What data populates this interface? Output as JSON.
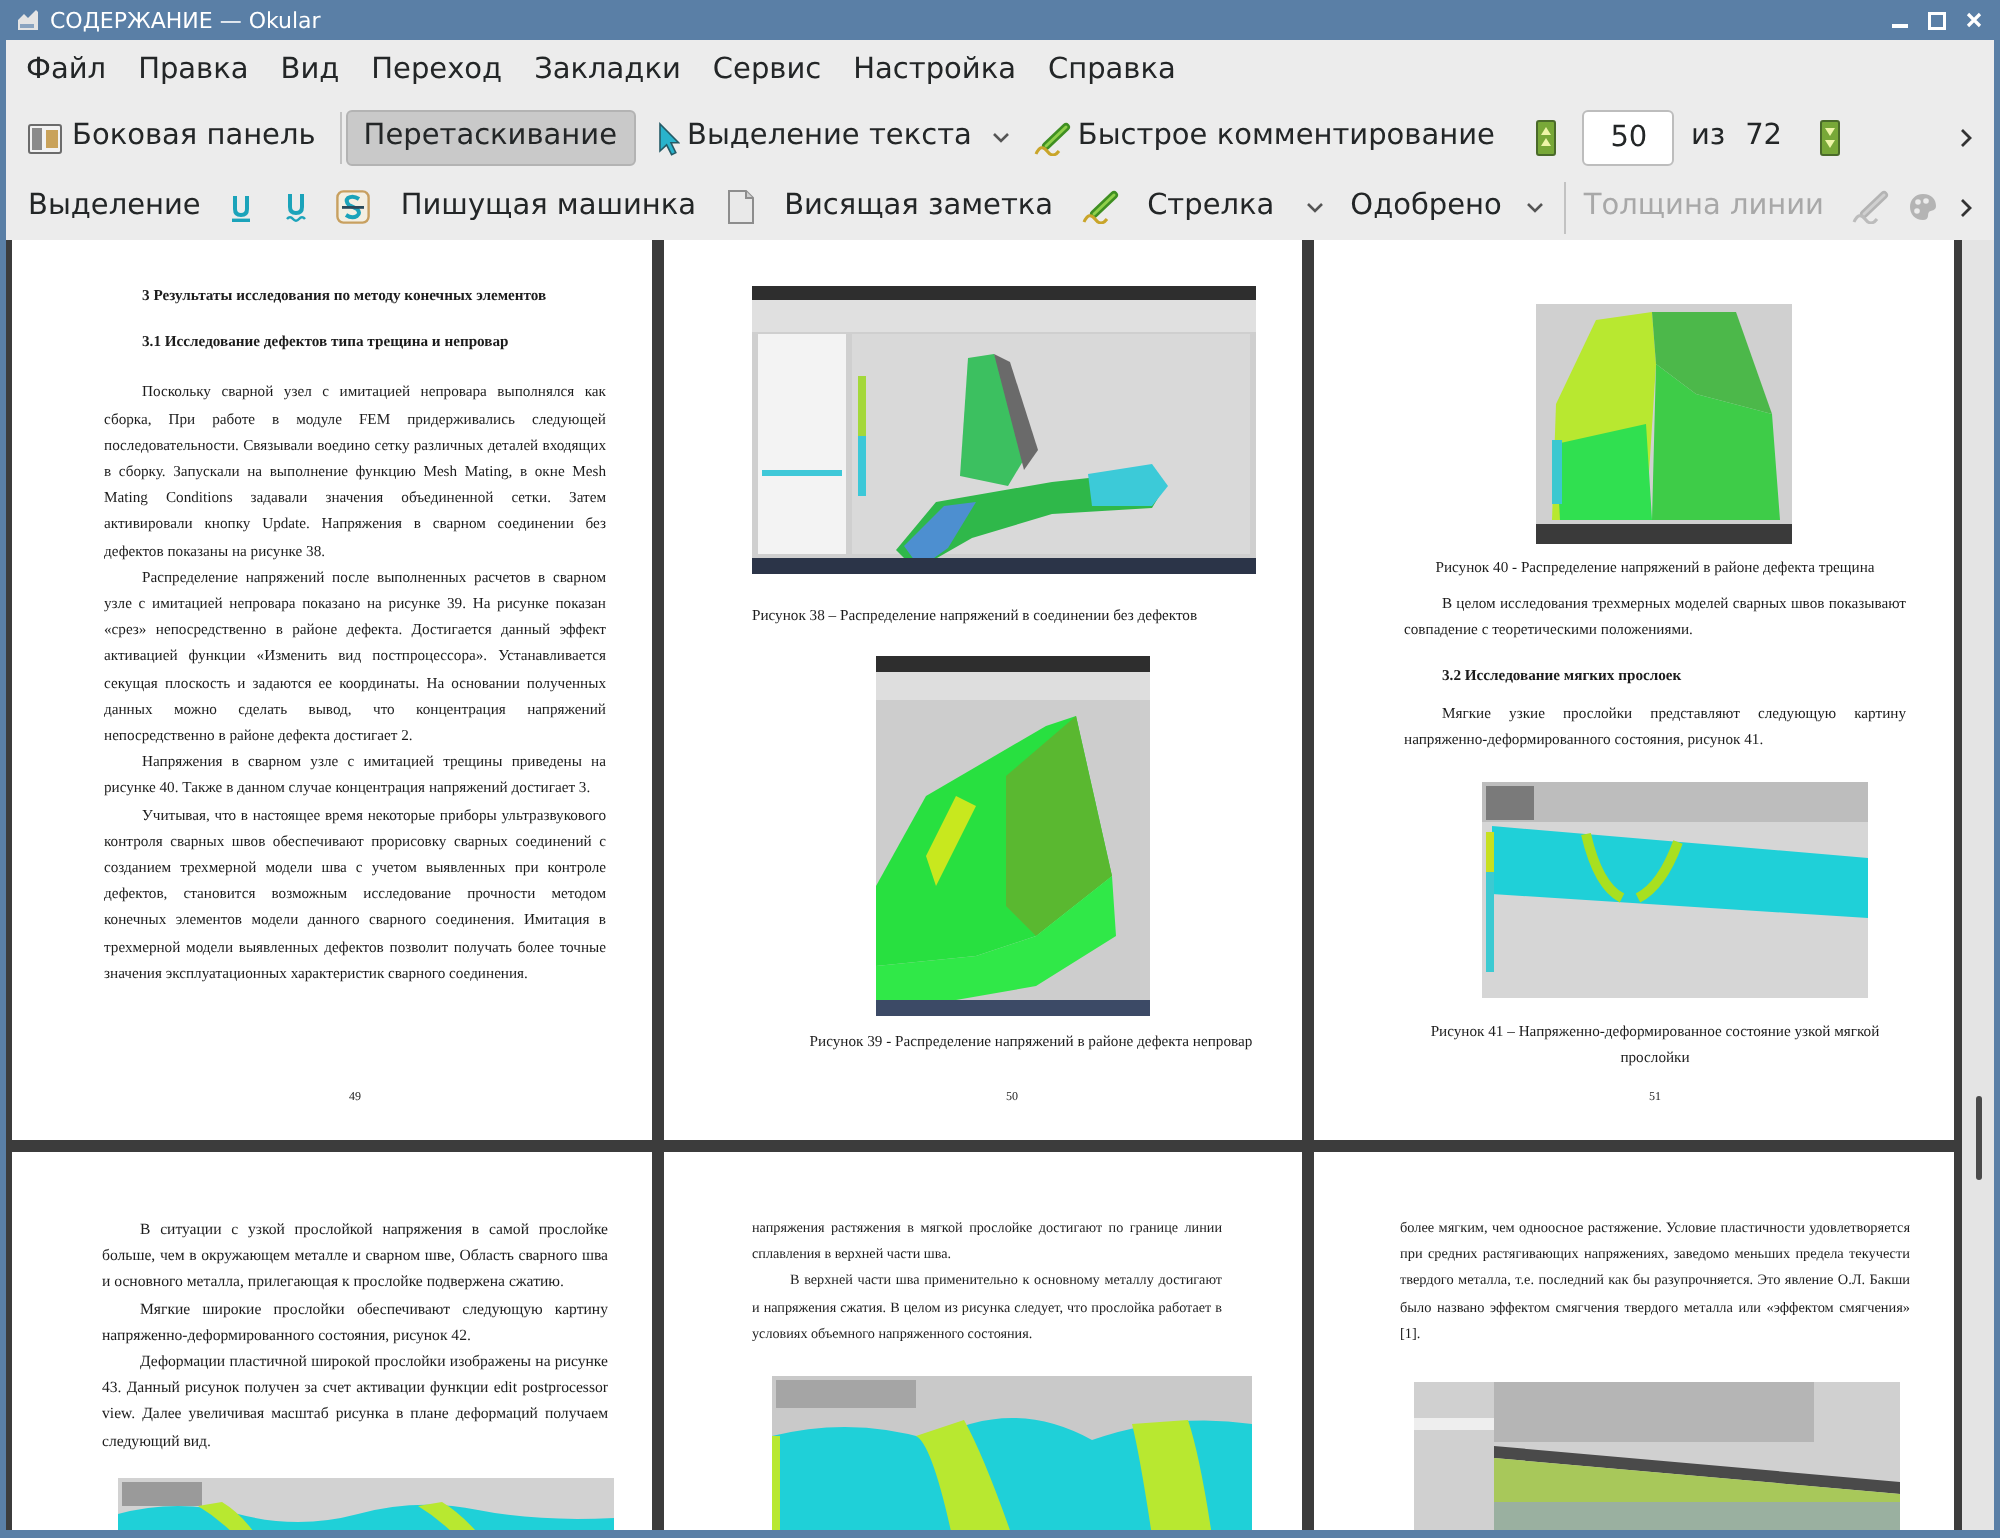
{
  "window": {
    "title": "СОДЕРЖАНИЕ — Okular"
  },
  "menu": [
    "Файл",
    "Правка",
    "Вид",
    "Переход",
    "Закладки",
    "Сервис",
    "Настройка",
    "Справка"
  ],
  "main_toolbar": {
    "sidebar_button": {
      "label": "Боковая панель"
    },
    "browse_tool": {
      "label": "Перетаскивание",
      "selected": true
    },
    "select_tool": {
      "label": "Выделение текста",
      "selected": false
    },
    "quick_annotations": {
      "label": "Быстрое комментирование"
    },
    "page": {
      "value": "50",
      "of_label": "из",
      "total": "72"
    }
  },
  "annotation_toolbar": {
    "highlight": {
      "label": "Выделение"
    },
    "typewriter": {
      "label": "Пишущая машинка"
    },
    "popup_note": {
      "label": "Висящая заметка"
    },
    "arrow": {
      "label": "Стрелка"
    },
    "stamp": {
      "label": "Одобрено"
    },
    "line_width": {
      "label": "Толщина линии",
      "disabled": true
    },
    "extra_buttons": [
      {
        "disabled": true
      },
      {
        "disabled": true
      }
    ]
  },
  "document": {
    "rows": [
      [
        {
          "number": "49",
          "blocks": [
            {
              "kind": "heading",
              "text": "3 Результаты исследования по методу конечных элементов"
            },
            {
              "kind": "heading",
              "text": "3.1 Исследование дефектов типа трещина и непровар"
            },
            {
              "kind": "paragraph",
              "text": "Поскольку сварной узел с имитацией непровара выполнялся как сборка, При работе в модуле FEM придерживались следующей последовательности. Связывали воедино сетку различных деталей входящих в сборку. Запускали на выполнение функцию Mesh Mating, в окне  Mesh Mating Conditions задавали значения объединенной сетки. Затем активировали кнопку Update. Напряжения в сварном соединении без дефектов показаны на рисунке 38."
            },
            {
              "kind": "paragraph",
              "text": "Распределение напряжений после выполненных расчетов в сварном узле с имитацией непровара показано на рисунке 39. На рисунке показан «срез» непосредственно в районе дефекта. Достигается данный эффект активацией функции «Изменить вид постпроцессора». Устанавливается секущая плоскость и задаются ее координаты. На основании полученных данных можно сделать вывод, что концентрация напряжений непосредственно в районе дефекта достигает 2."
            },
            {
              "kind": "paragraph",
              "text": "Напряжения в сварном узле с имитацией трещины приведены на рисунке 40. Также в данном случае концентрация напряжений достигает 3."
            },
            {
              "kind": "paragraph",
              "text": "Учитывая, что в настоящее время некоторые приборы ультразвукового контроля сварных швов обеспечивают прорисовку сварных соединений с созданием трехмерной модели шва с учетом выявленных при контроле дефектов, становится возможным исследование прочности методом конечных элементов модели данного сварного соединения. Имитация в трехмерной модели выявленных дефектов позволит получать более точные значения эксплуатационных характеристик сварного соединения."
            }
          ]
        },
        {
          "number": "50",
          "blocks": [
            {
              "kind": "figure"
            },
            {
              "kind": "caption",
              "text": "Рисунок 38 – Распределение напряжений в соединении без дефектов"
            },
            {
              "kind": "figure"
            },
            {
              "kind": "caption",
              "text": "Рисунок 39 - Распределение напряжений в районе дефекта непровар"
            }
          ]
        },
        {
          "number": "51",
          "blocks": [
            {
              "kind": "figure"
            },
            {
              "kind": "caption",
              "text": "Рисунок 40 - Распределение напряжений в районе дефекта трещина"
            },
            {
              "kind": "paragraph",
              "text": "В целом исследования трехмерных моделей сварных швов показывают совпадение с теоретическими положениями."
            },
            {
              "kind": "heading",
              "text": "3.2 Исследование мягких прослоек"
            },
            {
              "kind": "paragraph",
              "text": "Мягкие узкие прослойки представляют следующую картину напряженно-деформированного состояния, рисунок 41."
            },
            {
              "kind": "figure"
            },
            {
              "kind": "caption",
              "text": "Рисунок 41 – Напряженно-деформированное состояние узкой мягкой прослойки"
            }
          ]
        }
      ],
      [
        {
          "blocks": [
            {
              "kind": "paragraph",
              "text": "В ситуации с узкой прослойкой  напряжения в самой прослойке больше, чем в окружающем металле и сварном шве, Область сварного шва и основного металла, прилегающая к прослойке подвержена сжатию."
            },
            {
              "kind": "paragraph",
              "text": "Мягкие широкие прослойки обеспечивают следующую картину напряженно-деформированного состояния, рисунок 42."
            },
            {
              "kind": "paragraph",
              "text": "Деформации пластичной широкой прослойки изображены на рисунке 43. Данный рисунок получен за счет активации функции edit postprocessor view. Далее увеличивая масштаб рисунка в плане деформаций получаем следующий вид."
            },
            {
              "kind": "figure"
            }
          ]
        },
        {
          "blocks": [
            {
              "kind": "continuation",
              "text": "напряжения растяжения в мягкой прослойке достигают по границе линии сплавления в верхней части шва."
            },
            {
              "kind": "paragraph",
              "text": "В верхней части шва применительно к основному металлу достигают и напряжения сжатия. В целом из рисунка следует, что прослойка работает в условиях объемного напряженного состояния."
            },
            {
              "kind": "figure"
            }
          ]
        },
        {
          "blocks": [
            {
              "kind": "continuation",
              "text": "более мягким, чем одноосное растяжение. Условие пластичности удовлетворяется при средних растягивающих напряжениях, заведомо меньших предела текучести твердого металла, т.е. последний как бы разупрочняется. Это явление О.Л. Бакши было названо эффектом смягчения твердого металла или «эффектом смягчения» [1]."
            },
            {
              "kind": "figure"
            }
          ]
        }
      ]
    ]
  }
}
